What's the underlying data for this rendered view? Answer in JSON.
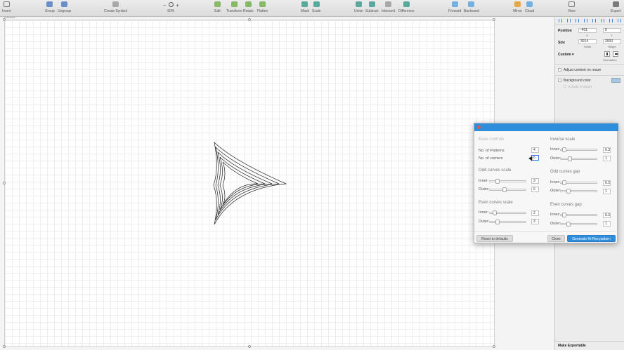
{
  "toolbar": {
    "insert": "Insert",
    "group": "Group",
    "ungroup": "Ungroup",
    "create_symbol": "Create Symbol",
    "zoom_minus": "−",
    "zoom_value": "50%",
    "zoom_plus": "+",
    "edit": "Edit",
    "transform": "Transform",
    "rotate": "Rotate",
    "flatten": "Flatten",
    "mask": "Mask",
    "scale": "Scale",
    "union": "Union",
    "subtract": "Subtract",
    "intersect": "Intersect",
    "difference": "Difference",
    "forward": "Forward",
    "backward": "Backward",
    "mirror": "Mirror",
    "cloud": "Cloud",
    "view": "View",
    "export": "Export"
  },
  "canvas": {
    "artboard_label": "Artboard"
  },
  "inspector": {
    "position_label": "Position",
    "x_value": "-401",
    "x_label": "X",
    "y_value": "0",
    "y_label": "Y",
    "size_label": "Size",
    "width_value": "3014",
    "width_label": "Width",
    "height_value": "2000",
    "height_label": "Height",
    "preset_label": "Custom ▾",
    "orientation_label": "Orientation",
    "adjust_content": "Adjust content on resize",
    "background_color": "Background color",
    "include_in_export": "Include in export",
    "make_exportable": "Make Exportable"
  },
  "dialog": {
    "base_controls": "Base controls",
    "patterns_label": "No. of Patterns",
    "patterns_value": "4",
    "corners_label": "No. of corners",
    "corners_value": "6",
    "odd_scale_title": "Odd curves scale",
    "even_scale_title": "Even curves scale",
    "inverse_scale_title": "Inverse scale",
    "odd_gap_title": "Odd curves gap",
    "even_gap_title": "Even curves gap",
    "inner_label": "Inner:",
    "outer_label": "Outer:",
    "odd_scale_inner": "3",
    "odd_scale_outer": "6",
    "even_scale_inner": "2",
    "even_scale_outer": "3",
    "inverse_inner": "0.3",
    "inverse_outer": "1",
    "odd_gap_inner": "0.3",
    "odd_gap_outer": "1",
    "even_gap_inner": "0.3",
    "even_gap_outer": "1",
    "reset_button": "Reset to defaults",
    "close_button": "Close",
    "generate_button": "Generate Hi-Res pattern"
  }
}
